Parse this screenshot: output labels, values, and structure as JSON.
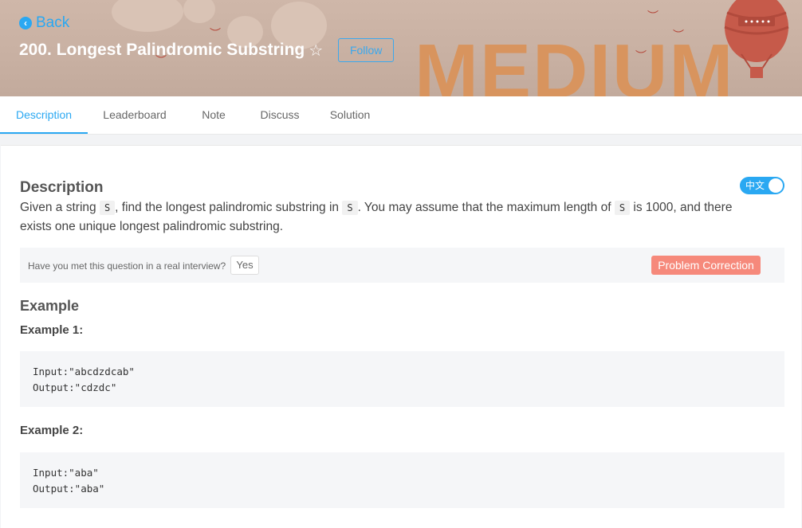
{
  "header": {
    "back_label": "Back",
    "title": "200. Longest Palindromic Substring",
    "follow_label": "Follow",
    "banner_word": "MEDIUM"
  },
  "tabs": [
    {
      "label": "Description",
      "active": true
    },
    {
      "label": "Leaderboard",
      "active": false
    },
    {
      "label": "Note",
      "active": false
    },
    {
      "label": "Discuss",
      "active": false
    },
    {
      "label": "Solution",
      "active": false
    }
  ],
  "description": {
    "heading": "Description",
    "lang_toggle_label": "中文",
    "text_part1": "Given a string ",
    "code_s": "S",
    "text_part2": ", find the longest palindromic substring in ",
    "text_part3": ". You may assume that the maximum length of ",
    "text_part4": " is 1000, and there exists one unique longest palindromic substring."
  },
  "interview": {
    "question": "Have you met this question in a real interview?",
    "yes_label": "Yes",
    "correction_label": "Problem Correction"
  },
  "examples": {
    "heading": "Example",
    "items": [
      {
        "title": "Example 1:",
        "input": "Input:\"abcdzdcab\"",
        "output": "Output:\"cdzdc\""
      },
      {
        "title": "Example 2:",
        "input": "Input:\"aba\"",
        "output": "Output:\"aba\""
      }
    ]
  },
  "colors": {
    "accent": "#2aa8f2",
    "correction": "#f6897b",
    "banner_word": "#d8945e"
  },
  "icons": {
    "back": "back-arrow-circle-icon",
    "star": "star-outline-icon"
  }
}
